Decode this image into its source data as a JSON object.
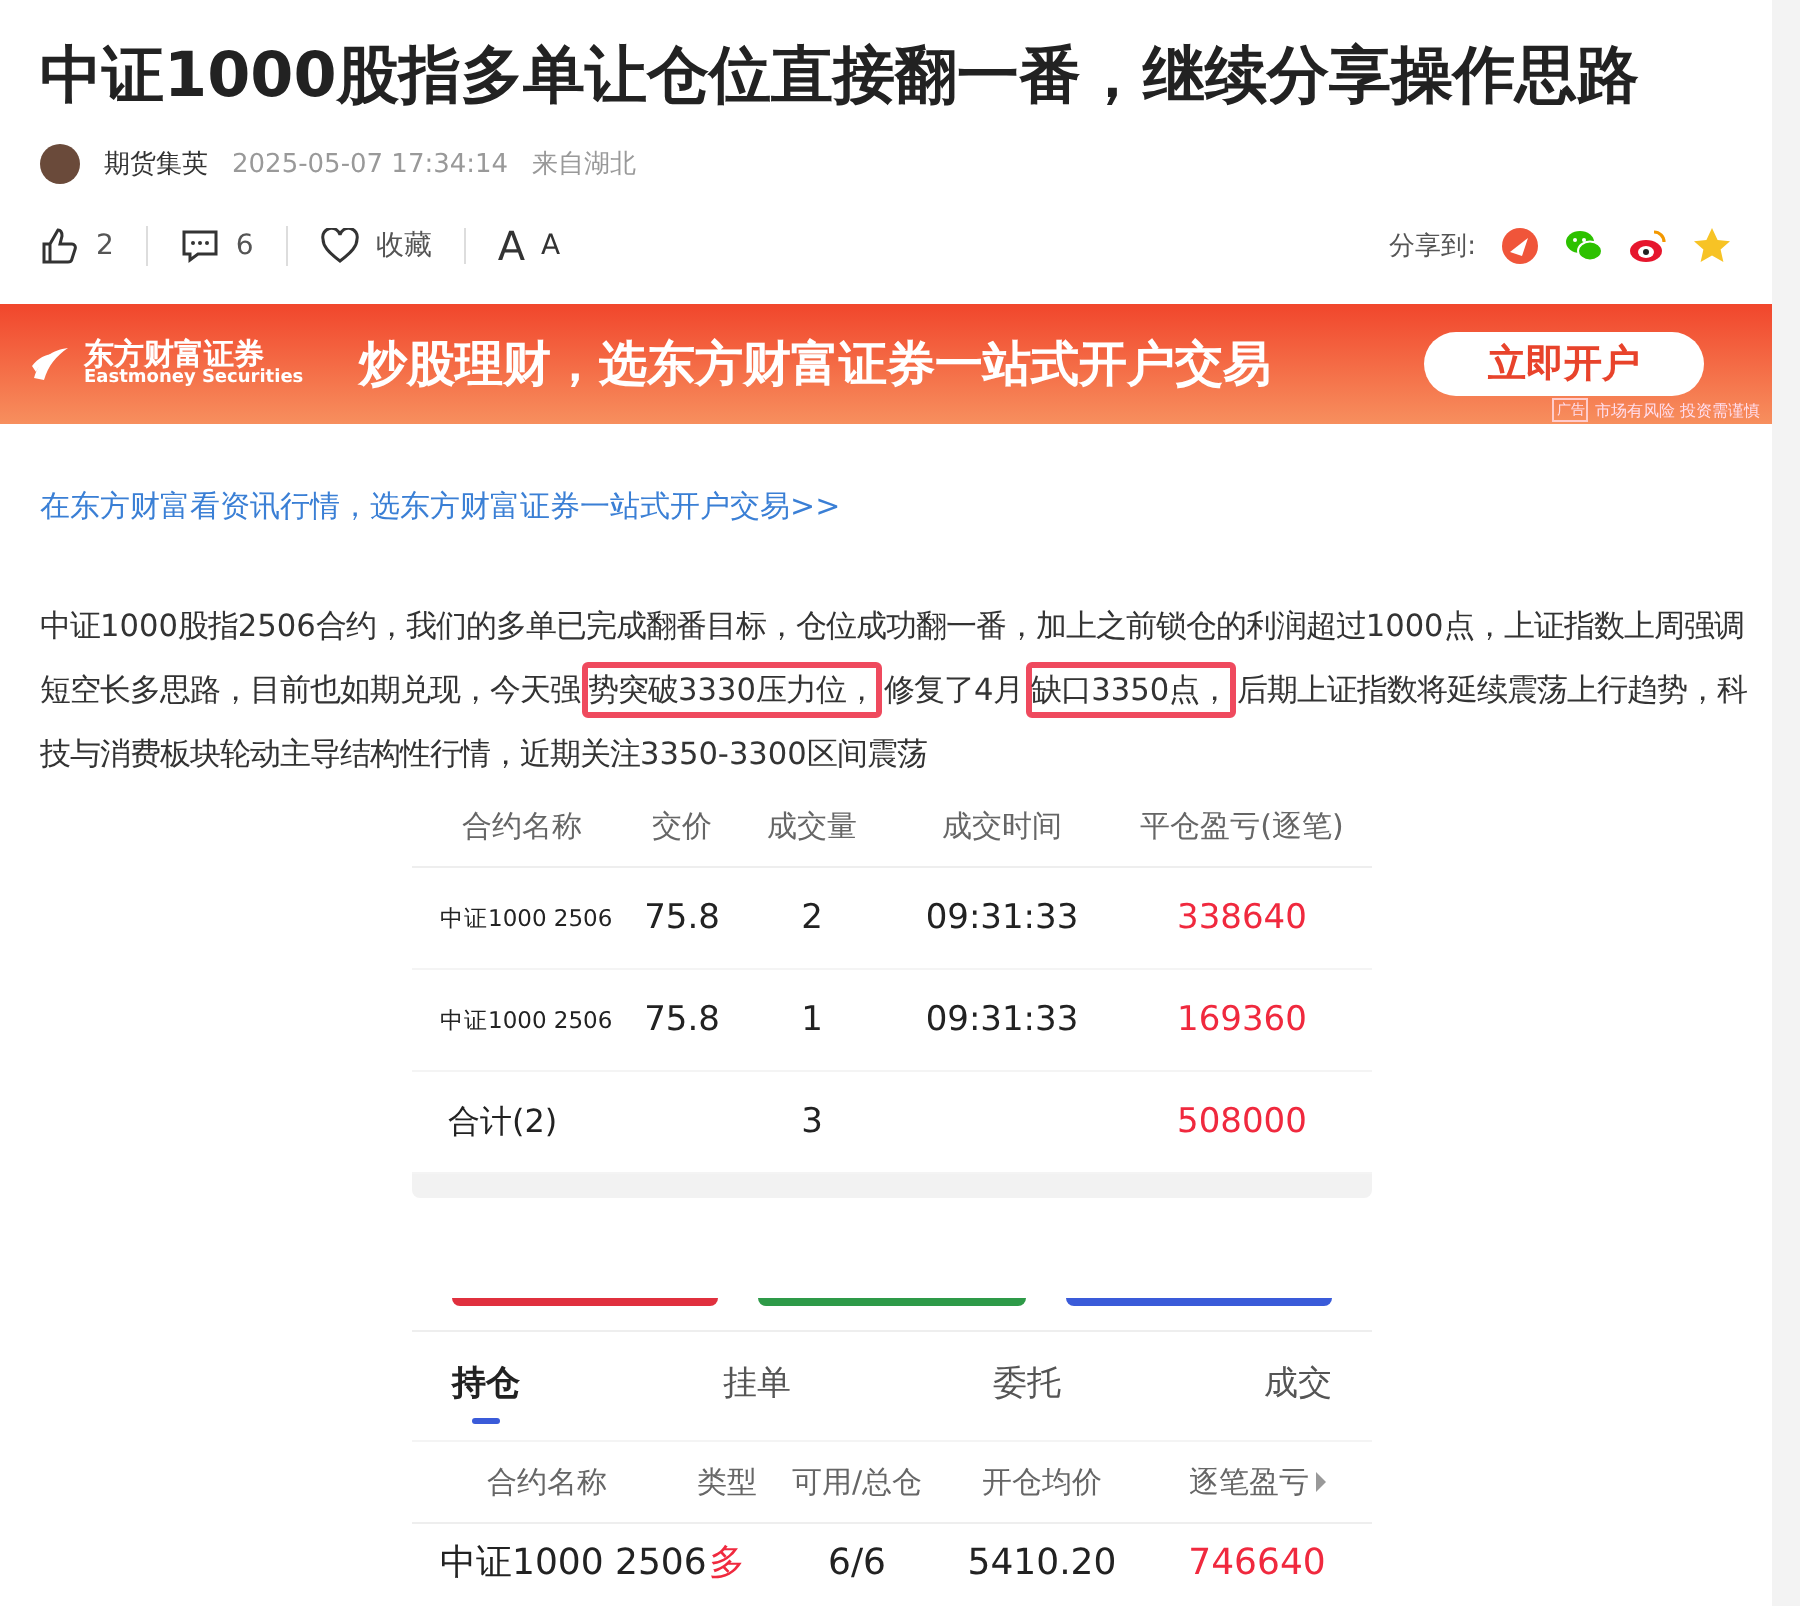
{
  "title": "中证1000股指多单让仓位直接翻一番，继续分享操作思路",
  "meta": {
    "author": "期货集英",
    "time": "2025-05-07 17:34:14",
    "location": "来自湖北"
  },
  "actions": [
    {
      "kind": "like",
      "label": "2"
    },
    {
      "kind": "comment",
      "label": "6"
    },
    {
      "kind": "favorite",
      "label": "收藏"
    },
    {
      "kind": "font",
      "label": "A",
      "label_small": "A"
    }
  ],
  "share": {
    "label": "分享到:",
    "targets": [
      {
        "kind": "toutiao",
        "color": "#f0553a"
      },
      {
        "kind": "wechat",
        "color": "#2dc100"
      },
      {
        "kind": "weibo",
        "color": "#e6162d"
      },
      {
        "kind": "star",
        "color": "#f7c325"
      }
    ]
  },
  "banner": {
    "brand": "东方财富证券",
    "brand_en": "Eastmoney Securities",
    "slogan": "炒股理财，选东方财富证券一站式开户交易",
    "button": "立即开户",
    "ad_tag": "广告",
    "disclaimer": "市场有风险 投资需谨慎"
  },
  "promo_link": "在东方财富看资讯行情，选东方财富证券一站式开户交易>>",
  "paragraph": [
    {
      "text": "中证1000股指2506合约，我们的多单已完成翻番目标，仓位成功翻一番，加上之前锁仓的利润超过1000点，上证指数上周强调短空长多思路，目前也如期兑现，今天强",
      "highlighted": false
    },
    {
      "text": "势突破3330压力位，",
      "highlighted": true
    },
    {
      "text": "修复了4月",
      "highlighted": false
    },
    {
      "text": "缺口3350点，",
      "highlighted": true
    },
    {
      "text": "后期上证指数将延续震荡上行趋势，科技与消费板块轮动主导结构性行情，近期关注3350-3300区间震荡",
      "highlighted": false
    }
  ],
  "trades_table": {
    "columns": [
      "合约名称",
      "交价",
      "成交量",
      "成交时间",
      "平仓盈亏(逐笔)"
    ],
    "rows": [
      [
        "中证1000 2506",
        "75.8",
        "2",
        "09:31:33",
        "338640"
      ],
      [
        "中证1000 2506",
        "75.8",
        "1",
        "09:31:33",
        "169360"
      ],
      [
        "合计(2)",
        "",
        "3",
        "",
        "508000"
      ]
    ]
  },
  "color_strips": [
    {
      "color": "#e0303e"
    },
    {
      "color": "#2e9a48"
    },
    {
      "color": "#3a5bd9"
    }
  ],
  "tabs": [
    {
      "label": "持仓",
      "selected": true
    },
    {
      "label": "挂单",
      "selected": false
    },
    {
      "label": "委托",
      "selected": false
    },
    {
      "label": "成交",
      "selected": false
    }
  ],
  "positions_table": {
    "columns": [
      "合约名称",
      "类型",
      "可用/总仓",
      "开仓均价",
      "逐笔盈亏"
    ],
    "rows": [
      [
        "中证1000 2506",
        "多",
        "6/6",
        "5410.20",
        "746640"
      ]
    ]
  }
}
